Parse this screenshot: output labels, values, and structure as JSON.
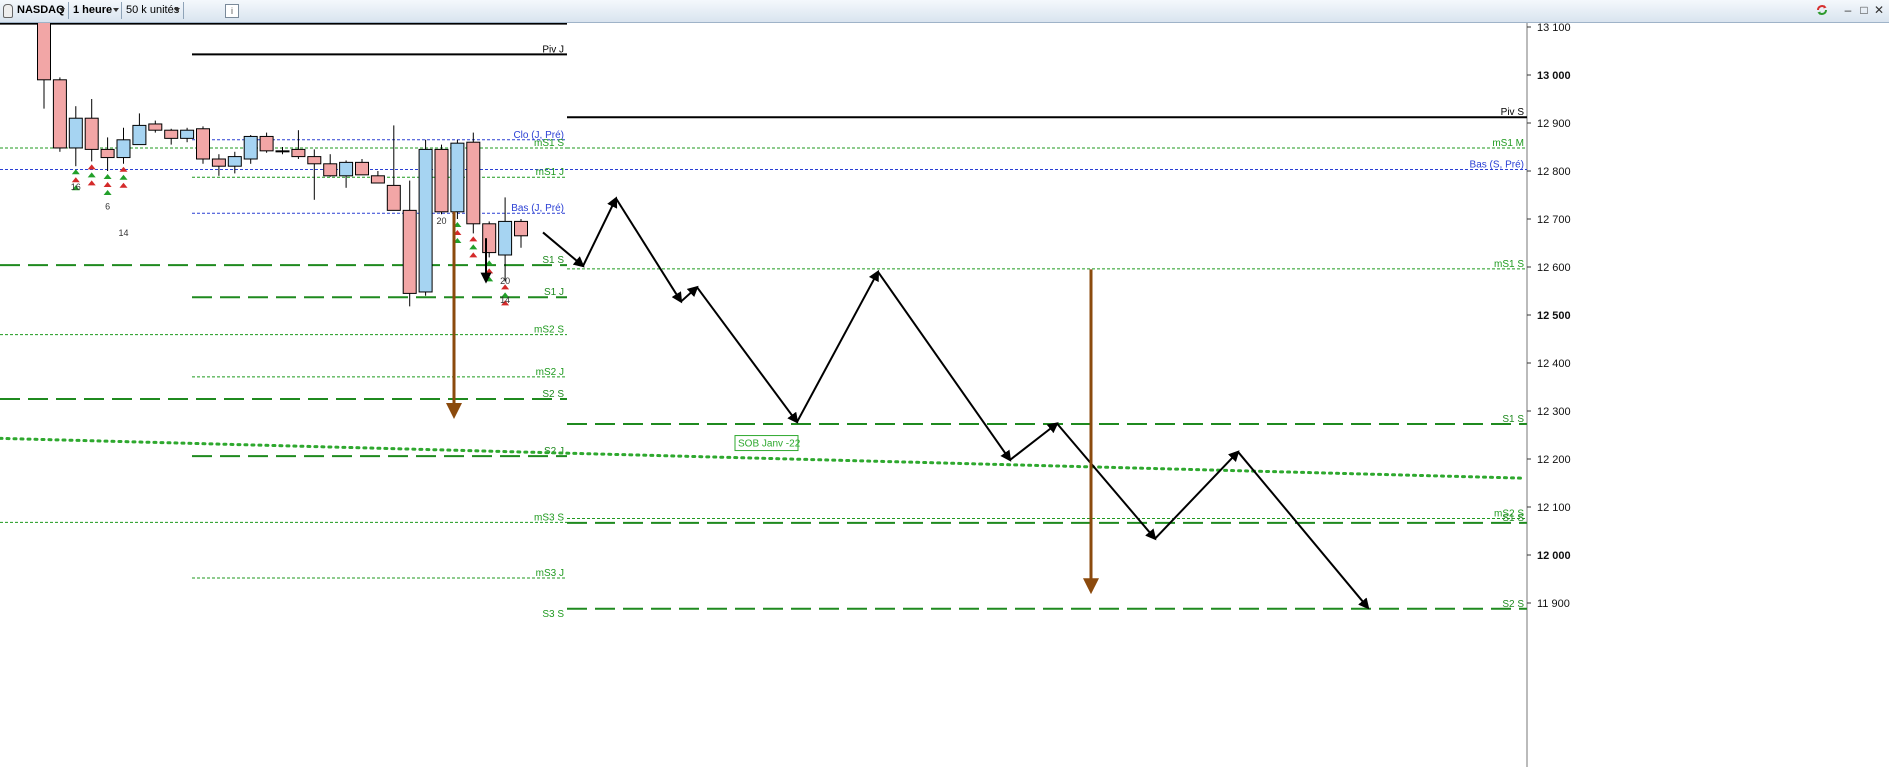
{
  "toolbar": {
    "symbol": "NASDAQ",
    "timeframe": "1 heure",
    "volume": "50 k unités",
    "info_label": "i",
    "window_controls": [
      "minimize-icon",
      "maximize-icon",
      "close-icon"
    ]
  },
  "chart_data": {
    "type": "candlestick",
    "instrument": "NASDAQ",
    "timeframe": "1 heure",
    "y_axis": {
      "ylim": [
        11860,
        13120
      ],
      "tick_values": [
        13100,
        13000,
        12900,
        12800,
        12700,
        12600,
        12500,
        12400,
        12300,
        12200,
        12100,
        12000,
        11900
      ],
      "tick_labels": [
        "13 100",
        "13 000",
        "12 900",
        "12 800",
        "12 700",
        "12 600",
        "12 500",
        "12 400",
        "12 300",
        "12 200",
        "12 100",
        "12 000",
        "11 900"
      ],
      "bold_ticks": [
        13000,
        12500,
        12000
      ]
    },
    "candles": [
      {
        "o": 13150,
        "h": 13200,
        "l": 12930,
        "c": 12990
      },
      {
        "o": 12990,
        "h": 12995,
        "l": 12840,
        "c": 12848
      },
      {
        "o": 12848,
        "h": 12935,
        "l": 12810,
        "c": 12910
      },
      {
        "o": 12910,
        "h": 12950,
        "l": 12820,
        "c": 12845
      },
      {
        "o": 12845,
        "h": 12870,
        "l": 12800,
        "c": 12828
      },
      {
        "o": 12828,
        "h": 12890,
        "l": 12815,
        "c": 12865
      },
      {
        "o": 12855,
        "h": 12920,
        "l": 12855,
        "c": 12895
      },
      {
        "o": 12898,
        "h": 12905,
        "l": 12880,
        "c": 12885
      },
      {
        "o": 12885,
        "h": 12888,
        "l": 12855,
        "c": 12868
      },
      {
        "o": 12868,
        "h": 12890,
        "l": 12860,
        "c": 12885
      },
      {
        "o": 12888,
        "h": 12893,
        "l": 12815,
        "c": 12825
      },
      {
        "o": 12825,
        "h": 12835,
        "l": 12790,
        "c": 12810
      },
      {
        "o": 12810,
        "h": 12840,
        "l": 12795,
        "c": 12830
      },
      {
        "o": 12825,
        "h": 12875,
        "l": 12815,
        "c": 12872
      },
      {
        "o": 12872,
        "h": 12880,
        "l": 12838,
        "c": 12842
      },
      {
        "o": 12842,
        "h": 12850,
        "l": 12835,
        "c": 12840
      },
      {
        "o": 12845,
        "h": 12885,
        "l": 12825,
        "c": 12830
      },
      {
        "o": 12830,
        "h": 12845,
        "l": 12740,
        "c": 12815
      },
      {
        "o": 12815,
        "h": 12835,
        "l": 12788,
        "c": 12790
      },
      {
        "o": 12790,
        "h": 12822,
        "l": 12765,
        "c": 12818
      },
      {
        "o": 12818,
        "h": 12825,
        "l": 12795,
        "c": 12792
      },
      {
        "o": 12790,
        "h": 12800,
        "l": 12775,
        "c": 12775
      },
      {
        "o": 12770,
        "h": 12895,
        "l": 12720,
        "c": 12718
      },
      {
        "o": 12718,
        "h": 12780,
        "l": 12518,
        "c": 12545
      },
      {
        "o": 12548,
        "h": 12865,
        "l": 12540,
        "c": 12845
      },
      {
        "o": 12845,
        "h": 12855,
        "l": 12710,
        "c": 12715
      },
      {
        "o": 12715,
        "h": 12865,
        "l": 12700,
        "c": 12858
      },
      {
        "o": 12860,
        "h": 12880,
        "l": 12670,
        "c": 12690
      },
      {
        "o": 12690,
        "h": 12695,
        "l": 12620,
        "c": 12630
      },
      {
        "o": 12625,
        "h": 12745,
        "l": 12570,
        "c": 12695
      },
      {
        "o": 12695,
        "h": 12700,
        "l": 12640,
        "c": 12665
      }
    ],
    "levels": [
      {
        "label": "Piv S",
        "value": 13107,
        "style": "solid",
        "color": "#000000",
        "span": "left"
      },
      {
        "label": "Piv J",
        "value": 13043,
        "style": "solid",
        "color": "#000000",
        "span": "mid"
      },
      {
        "label": "Piv S",
        "value": 12912,
        "style": "solid",
        "color": "#000000",
        "span": "right"
      },
      {
        "label": "Clo (J, Pré)",
        "value": 12865,
        "style": "dash-small",
        "color": "#2a3fd4",
        "span": "mid"
      },
      {
        "label": "mS1 S",
        "value": 12848,
        "style": "dash-small",
        "color": "#1f9a1f",
        "span": "left"
      },
      {
        "label": "mS1 M",
        "value": 12848,
        "style": "dash-small",
        "color": "#1f9a1f",
        "span": "right"
      },
      {
        "label": "Bas (S, Pré)",
        "value": 12803,
        "style": "dash-small",
        "color": "#2a3fd4",
        "span": "full"
      },
      {
        "label": "mS1 J",
        "value": 12787,
        "style": "dash-small",
        "color": "#1f9a1f",
        "span": "mid"
      },
      {
        "label": "Bas (J, Pré)",
        "value": 12712,
        "style": "dash-small",
        "color": "#2a3fd4",
        "span": "mid"
      },
      {
        "label": "S1 S",
        "value": 12604,
        "style": "dash-long",
        "color": "#1f8a1f",
        "span": "left"
      },
      {
        "label": "mS1 S",
        "value": 12596,
        "style": "dash-small",
        "color": "#1f9a1f",
        "span": "right"
      },
      {
        "label": "S1 J",
        "value": 12537,
        "style": "dash-long",
        "color": "#1f8a1f",
        "span": "mid"
      },
      {
        "label": "mS2 S",
        "value": 12459,
        "style": "dash-small",
        "color": "#1f9a1f",
        "span": "left"
      },
      {
        "label": "mS2 J",
        "value": 12371,
        "style": "dash-small",
        "color": "#1f9a1f",
        "span": "mid"
      },
      {
        "label": "S2 S",
        "value": 12325,
        "style": "dash-long",
        "color": "#1f8a1f",
        "span": "left"
      },
      {
        "label": "S1 S",
        "value": 12273,
        "style": "dash-long",
        "color": "#1f8a1f",
        "span": "right"
      },
      {
        "label": "S2 J",
        "value": 12206,
        "style": "dash-long",
        "color": "#1f8a1f",
        "span": "mid"
      },
      {
        "label": "mS3 S",
        "value": 12068,
        "style": "dash-small",
        "color": "#1f9a1f",
        "span": "left"
      },
      {
        "label": "mS2 S",
        "value": 12076,
        "style": "dash-small",
        "color": "#1f9a1f",
        "span": "right"
      },
      {
        "label": "S1 S",
        "value": 12067,
        "style": "dash-long",
        "color": "#1f8a1f",
        "span": "right"
      },
      {
        "label": "mS3 J",
        "value": 11952,
        "style": "dash-small",
        "color": "#1f9a1f",
        "span": "mid"
      },
      {
        "label": "S2 S",
        "value": 11888,
        "style": "dash-long",
        "color": "#1f8a1f",
        "span": "right"
      },
      {
        "label": "S3 S",
        "value": 11867,
        "style": "none",
        "color": "#1f9a1f",
        "span": "left"
      }
    ],
    "trendline": {
      "label": "SOB Janv -22",
      "from": [
        0,
        12243
      ],
      "to": [
        1525,
        12160
      ],
      "color": "#2ea82e"
    },
    "projection_path": [
      [
        543,
        12672
      ],
      [
        583,
        12602
      ],
      [
        616,
        12743
      ],
      [
        681,
        12528
      ],
      [
        697,
        12558
      ],
      [
        797,
        12277
      ],
      [
        878,
        12590
      ],
      [
        1010,
        12198
      ],
      [
        1057,
        12274
      ],
      [
        1155,
        12034
      ],
      [
        1238,
        12215
      ],
      [
        1368,
        11890
      ]
    ],
    "target_arrows": [
      {
        "x": 454,
        "from": 12715,
        "to": 12290,
        "color": "#8b4a0d"
      },
      {
        "x": 1091,
        "from": 12595,
        "to": 11925,
        "color": "#8b4a0d"
      }
    ],
    "candle_labels": [
      "16",
      "6",
      "14",
      "20",
      "20",
      "14"
    ],
    "colors": {
      "up": "#a6d4f2",
      "down": "#f2a6a6",
      "outline": "#000000",
      "signal_green": "#22a02a",
      "signal_red": "#d42a2a"
    }
  }
}
